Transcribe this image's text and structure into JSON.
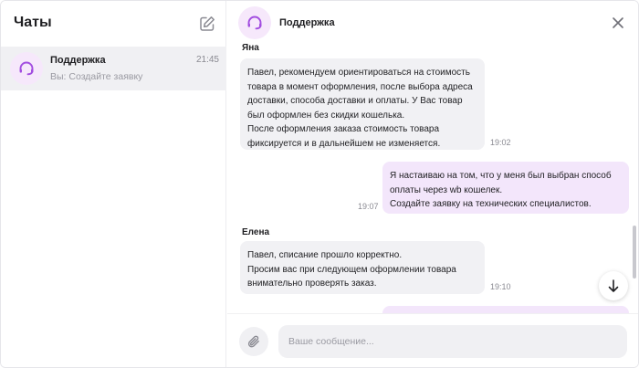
{
  "sidebar": {
    "title": "Чаты",
    "chats": [
      {
        "name": "Поддержка",
        "time": "21:45",
        "preview": "Вы: Создайте заявку"
      }
    ]
  },
  "chat": {
    "title": "Поддержка",
    "messages": [
      {
        "author": "Яна",
        "direction": "incoming",
        "text": "Павел, рекомендуем ориентироваться на стоимость\nтовара в момент оформления, после выбора адреса\nдоставки, способа доставки и оплаты. У Вас товар\nбыл оформлен без скидки кошелька.\nПосле оформления заказа стоимость товара\nфиксируется и в дальнейшем не изменяется.",
        "time": "19:02"
      },
      {
        "author": "",
        "direction": "outgoing",
        "text": "Я настаиваю на том, что у меня был выбран способ\nоплаты через wb кошелек.\nСоздайте заявку на технических специалистов.",
        "time": "19:07"
      },
      {
        "author": "Елена",
        "direction": "incoming",
        "text": "Павел, списание прошло корректно.\nПросим вас при следующем оформлении товара\nвнимательно проверять заказ.",
        "time": "19:10"
      }
    ]
  },
  "composer": {
    "placeholder": "Ваше сообщение..."
  },
  "colors": {
    "accent": "#a24de0",
    "avatar_bg": "#f6e8fb",
    "incoming_bubble": "#f1f1f4",
    "outgoing_bubble": "#f3e6fb",
    "selected_chat": "#f0f0f3"
  },
  "icons": {
    "compose": "edit-square-icon",
    "avatar": "headset-icon",
    "close": "close-icon",
    "scroll_down": "arrow-down-icon",
    "attach": "paperclip-icon"
  }
}
